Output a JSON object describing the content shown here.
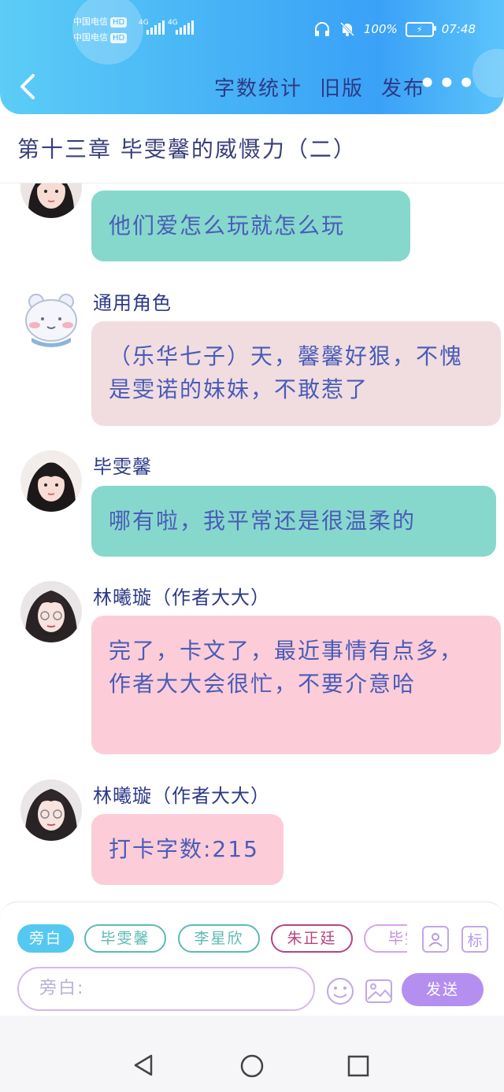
{
  "status_bar": {
    "carrier_1": "中国电信",
    "carrier_2": "中国电信",
    "hd": "HD",
    "network_1": "4G",
    "network_2": "4G",
    "battery": "100%",
    "time": "07:48"
  },
  "header": {
    "actions": [
      "字数统计",
      "旧版",
      "发布"
    ],
    "more": "•••"
  },
  "chapter_title": "第十三章  毕雯馨的威慑力（二）",
  "messages": [
    {
      "speaker": "",
      "text": "他们爱怎么玩就怎么玩",
      "color": "#86d8cc"
    },
    {
      "speaker": "通用角色",
      "text": "（乐华七子）天，馨馨好狠，不愧是雯诺的妹妹，不敢惹了",
      "color": "#f1dde0"
    },
    {
      "speaker": "毕雯馨",
      "text": "哪有啦，我平常还是很温柔的",
      "color": "#86d8cc"
    },
    {
      "speaker": "林曦璇（作者大大）",
      "text": "完了，卡文了，最近事情有点多，作者大大会很忙，不要介意哈",
      "color": "#fccdd8"
    },
    {
      "speaker": "林曦璇（作者大大）",
      "text": "打卡字数:215",
      "color": "#fccdd8"
    }
  ],
  "composer": {
    "roles": [
      {
        "label": "旁白",
        "color": "#55c8f1",
        "active": true
      },
      {
        "label": "毕雯馨",
        "color": "#5cbab3",
        "active": false
      },
      {
        "label": "李星欣",
        "color": "#5cbab3",
        "active": false
      },
      {
        "label": "朱正廷",
        "color": "#b5457e",
        "active": false
      },
      {
        "label": "毕雯",
        "color": "#d8a3ea",
        "active": false
      }
    ],
    "tag_label": "标",
    "input_placeholder": "旁白:",
    "send_label": "发送"
  }
}
